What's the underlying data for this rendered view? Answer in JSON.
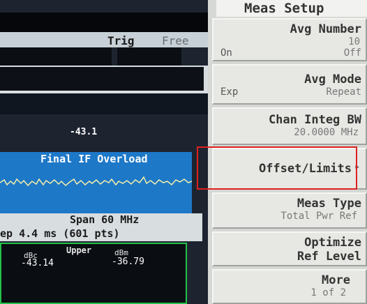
{
  "display": {
    "trigger_label": "Trig",
    "trigger_value": "Free",
    "top_value": "-43.1",
    "overload_message": "Final IF Overload",
    "span": "Span 60 MHz",
    "sweep": "ep 4.4 ms (601 pts)",
    "results": {
      "upper_label": "Upper",
      "dbc_unit": "dBc",
      "dbm_unit": "dBm",
      "dbc_value": "-43.14",
      "dbm_value": "-36.79"
    }
  },
  "menu": {
    "title": "Meas Setup",
    "keys": [
      {
        "label": "Avg Number",
        "left": "On",
        "right": "Off",
        "value": "10"
      },
      {
        "label": "Avg Mode",
        "left": "Exp",
        "right": "Repeat"
      },
      {
        "label": "Chan Integ BW",
        "value": "20.0000 MHz"
      },
      {
        "label": "Offset/Limits",
        "arrow": "▸"
      },
      {
        "label": "Meas Type",
        "value": "Total Pwr Ref"
      },
      {
        "label": "Optimize",
        "label2": "Ref Level"
      },
      {
        "label": "More",
        "value": "1 of 2"
      }
    ]
  },
  "colors": {
    "highlight": "#e0201e",
    "plot_background": "#1e78c8",
    "results_border": "#23c14a"
  }
}
